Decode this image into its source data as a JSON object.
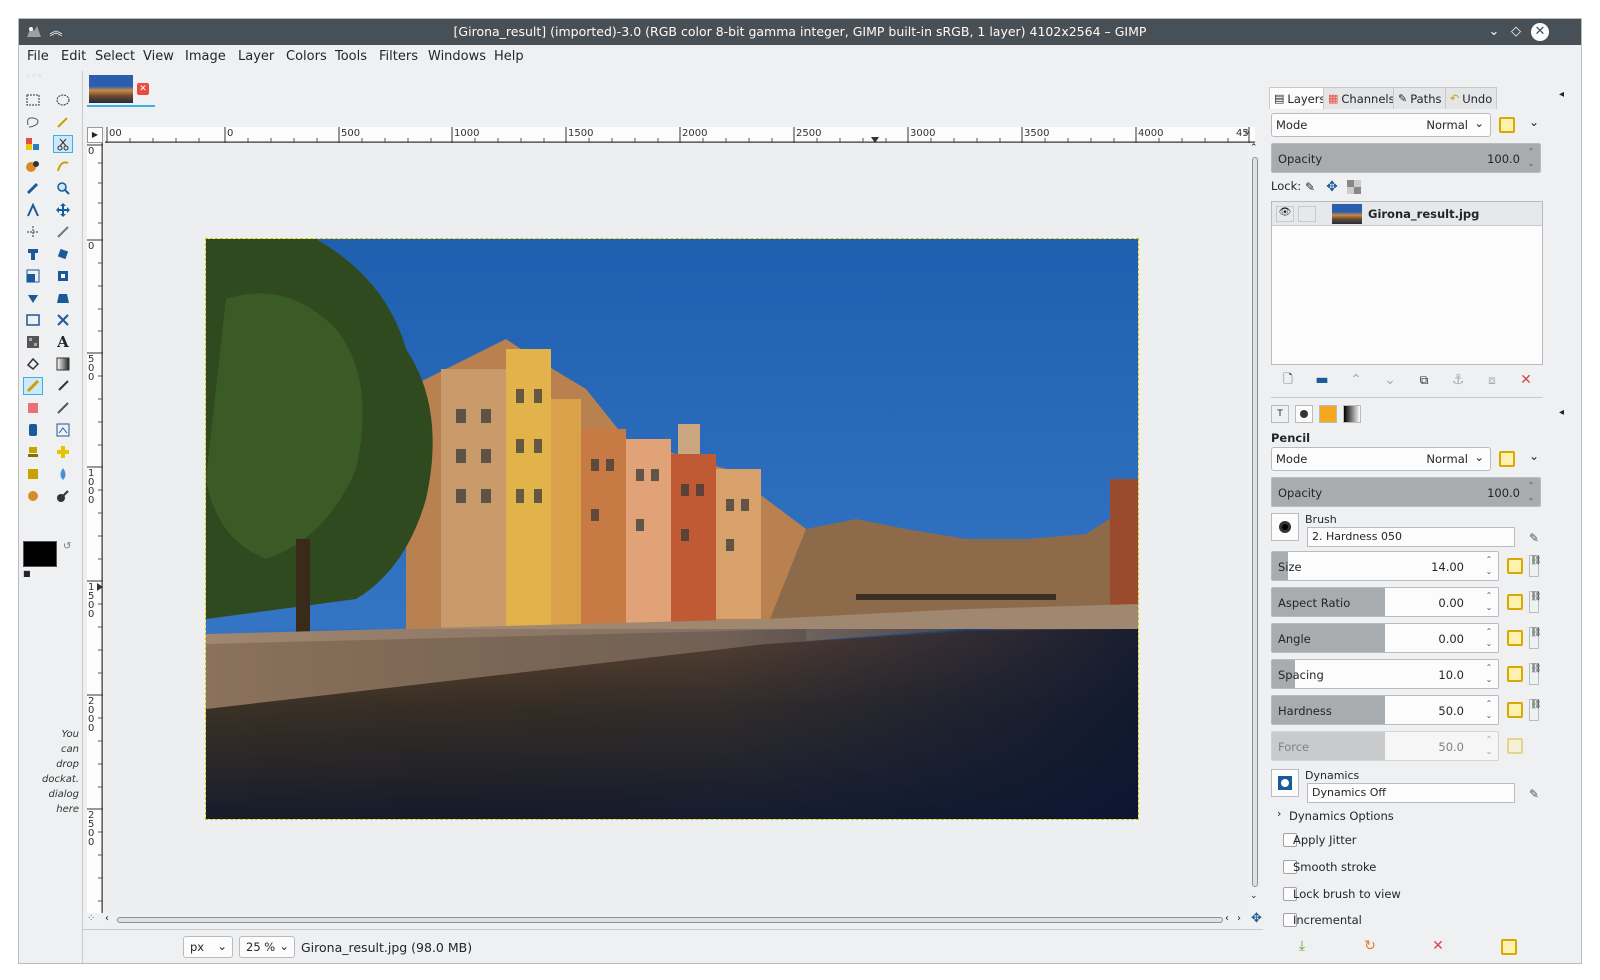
{
  "window": {
    "title": "[Girona_result] (imported)-3.0 (RGB color 8-bit gamma integer, GIMP built-in sRGB, 1 layer) 4102x2564 – GIMP"
  },
  "menu": [
    "File",
    "Edit",
    "Select",
    "View",
    "Image",
    "Layer",
    "Colors",
    "Tools",
    "Filters",
    "Windows",
    "Help"
  ],
  "toolbox": {
    "hint": [
      "You",
      "can",
      "drop",
      "dockat.",
      "dialog",
      "here"
    ],
    "fg_color": "#000000",
    "bg_color": "#ffffff"
  },
  "ruler": {
    "h_labels": [
      "00",
      "0",
      "500",
      "1000",
      "1500",
      "2000",
      "2500",
      "3000",
      "3500",
      "4000",
      "45"
    ],
    "v_labels": [
      "0",
      "0",
      "500",
      "1000",
      "1500",
      "2000",
      "2500"
    ]
  },
  "statusbar": {
    "unit": "px",
    "zoom": "25 %",
    "file_info": "Girona_result.jpg (98.0 MB)"
  },
  "layers_dock": {
    "tabs": [
      "Layers",
      "Channels",
      "Paths",
      "Undo"
    ],
    "mode_label": "Mode",
    "mode_value": "Normal",
    "opacity_label": "Opacity",
    "opacity_value": "100.0",
    "lock_label": "Lock:",
    "layer_name": "Girona_result.jpg"
  },
  "tool_options": {
    "tool_name": "Pencil",
    "mode_label": "Mode",
    "mode_value": "Normal",
    "opacity_label": "Opacity",
    "opacity_value": "100.0",
    "brush_label": "Brush",
    "brush_value": "2. Hardness 050",
    "sliders": [
      {
        "label": "Size",
        "value": "14.00",
        "fill": 0.07
      },
      {
        "label": "Aspect Ratio",
        "value": "0.00",
        "fill": 0.5
      },
      {
        "label": "Angle",
        "value": "0.00",
        "fill": 0.5
      },
      {
        "label": "Spacing",
        "value": "10.0",
        "fill": 0.1
      },
      {
        "label": "Hardness",
        "value": "50.0",
        "fill": 0.5
      },
      {
        "label": "Force",
        "value": "50.0",
        "fill": 0.5
      }
    ],
    "dynamics_label": "Dynamics",
    "dynamics_value": "Dynamics Off",
    "dynamics_options": "Dynamics Options",
    "checkboxes": [
      "Apply Jitter",
      "Smooth stroke",
      "Lock brush to view",
      "Incremental"
    ]
  }
}
